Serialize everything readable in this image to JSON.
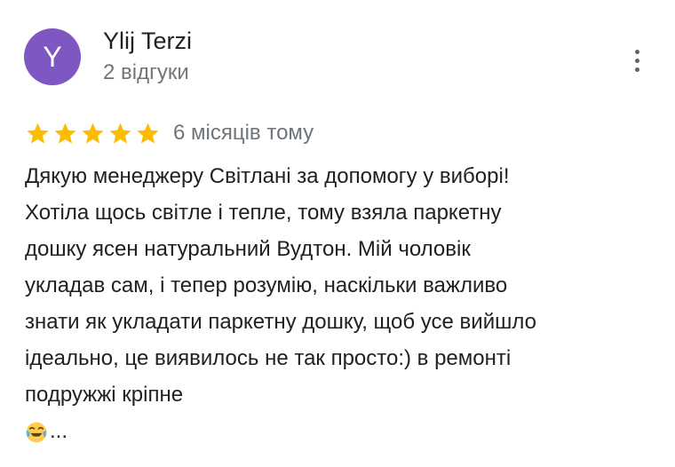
{
  "review": {
    "author": {
      "initial": "Y",
      "name": "Ylij Terzi",
      "review_count": "2 відгуки",
      "avatar_color": "#7e57c2"
    },
    "more_options_icon": "more-vert-icon",
    "rating": 5,
    "max_rating": 5,
    "star_color": "#fbbc04",
    "date": "6 місяців тому",
    "text_lines": [
      "Дякую менеджеру Світлані за допомогу у виборі!",
      "Хотіла щось світле і тепле, тому взяла паркетну",
      "дошку ясен натуральний Вудтон. Мій чоловік",
      "укладав сам, і тепер розумію, наскільки важливо",
      "знати як укладати паркетну дошку, щоб усе вийшло",
      "ідеально, це виявилось не так просто:) в ремонті",
      "подружжі кріпне"
    ],
    "trailing_emoji": "face-with-tears-of-joy-icon",
    "truncation": "..."
  }
}
